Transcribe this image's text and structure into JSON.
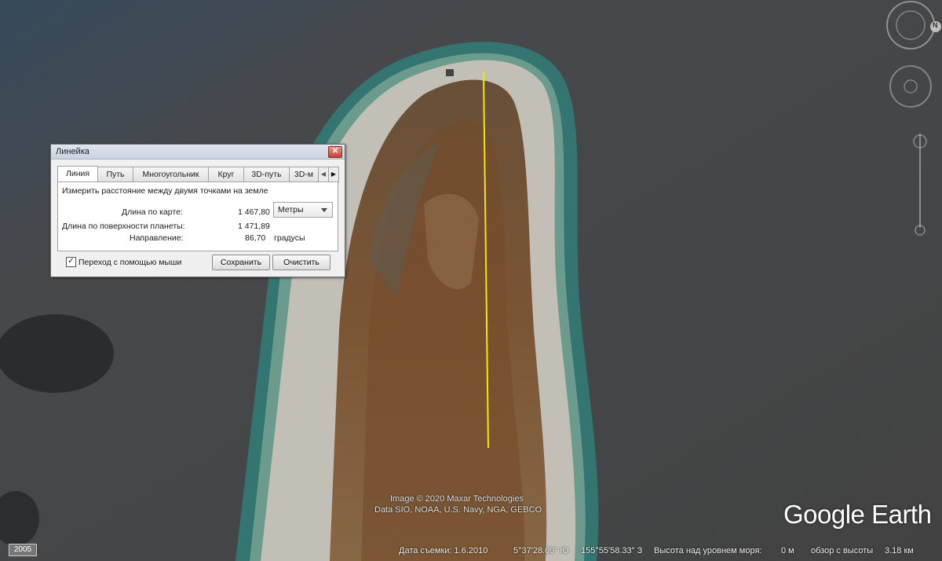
{
  "dialog": {
    "title": "Линейка",
    "tabs": [
      "Линия",
      "Путь",
      "Многоугольник",
      "Круг",
      "3D-путь",
      "3D-м"
    ],
    "description": "Измерить расстояние между двумя точками на земле",
    "map_length_label": "Длина по карте:",
    "map_length_value": "1 467,80",
    "units": "Метры",
    "surface_length_label": "Длина по поверхности планеты:",
    "surface_length_value": "1 471,89",
    "direction_label": "Направление:",
    "direction_value": "86,70",
    "direction_unit": "градусы",
    "mouse_nav_label": "Переход с помощью мыши",
    "mouse_nav_checked": true,
    "save_label": "Сохранить",
    "clear_label": "Очистить"
  },
  "credits": {
    "line1": "Image © 2020 Maxar Technologies",
    "line2": "Data SIO, NOAA, U.S. Navy, NGA, GEBCO"
  },
  "brand": "Google Earth",
  "statusbar": {
    "year": "2005",
    "date": "Дата съемки: 1.6.2010",
    "lat": "5°37'28.09\" Ю",
    "lon": "155°55'58.33\" З",
    "elevation_label": "Высота над уровнем моря:",
    "elevation_value": "0 м",
    "eye_alt_label": "обзор с высоты",
    "eye_alt_value": "3.18 км"
  },
  "nav": {
    "north_label": "N"
  },
  "colors": {
    "ruler_line": "#f5e60a",
    "ocean": "#4a4c4a",
    "sand": "#e6e2d8"
  }
}
